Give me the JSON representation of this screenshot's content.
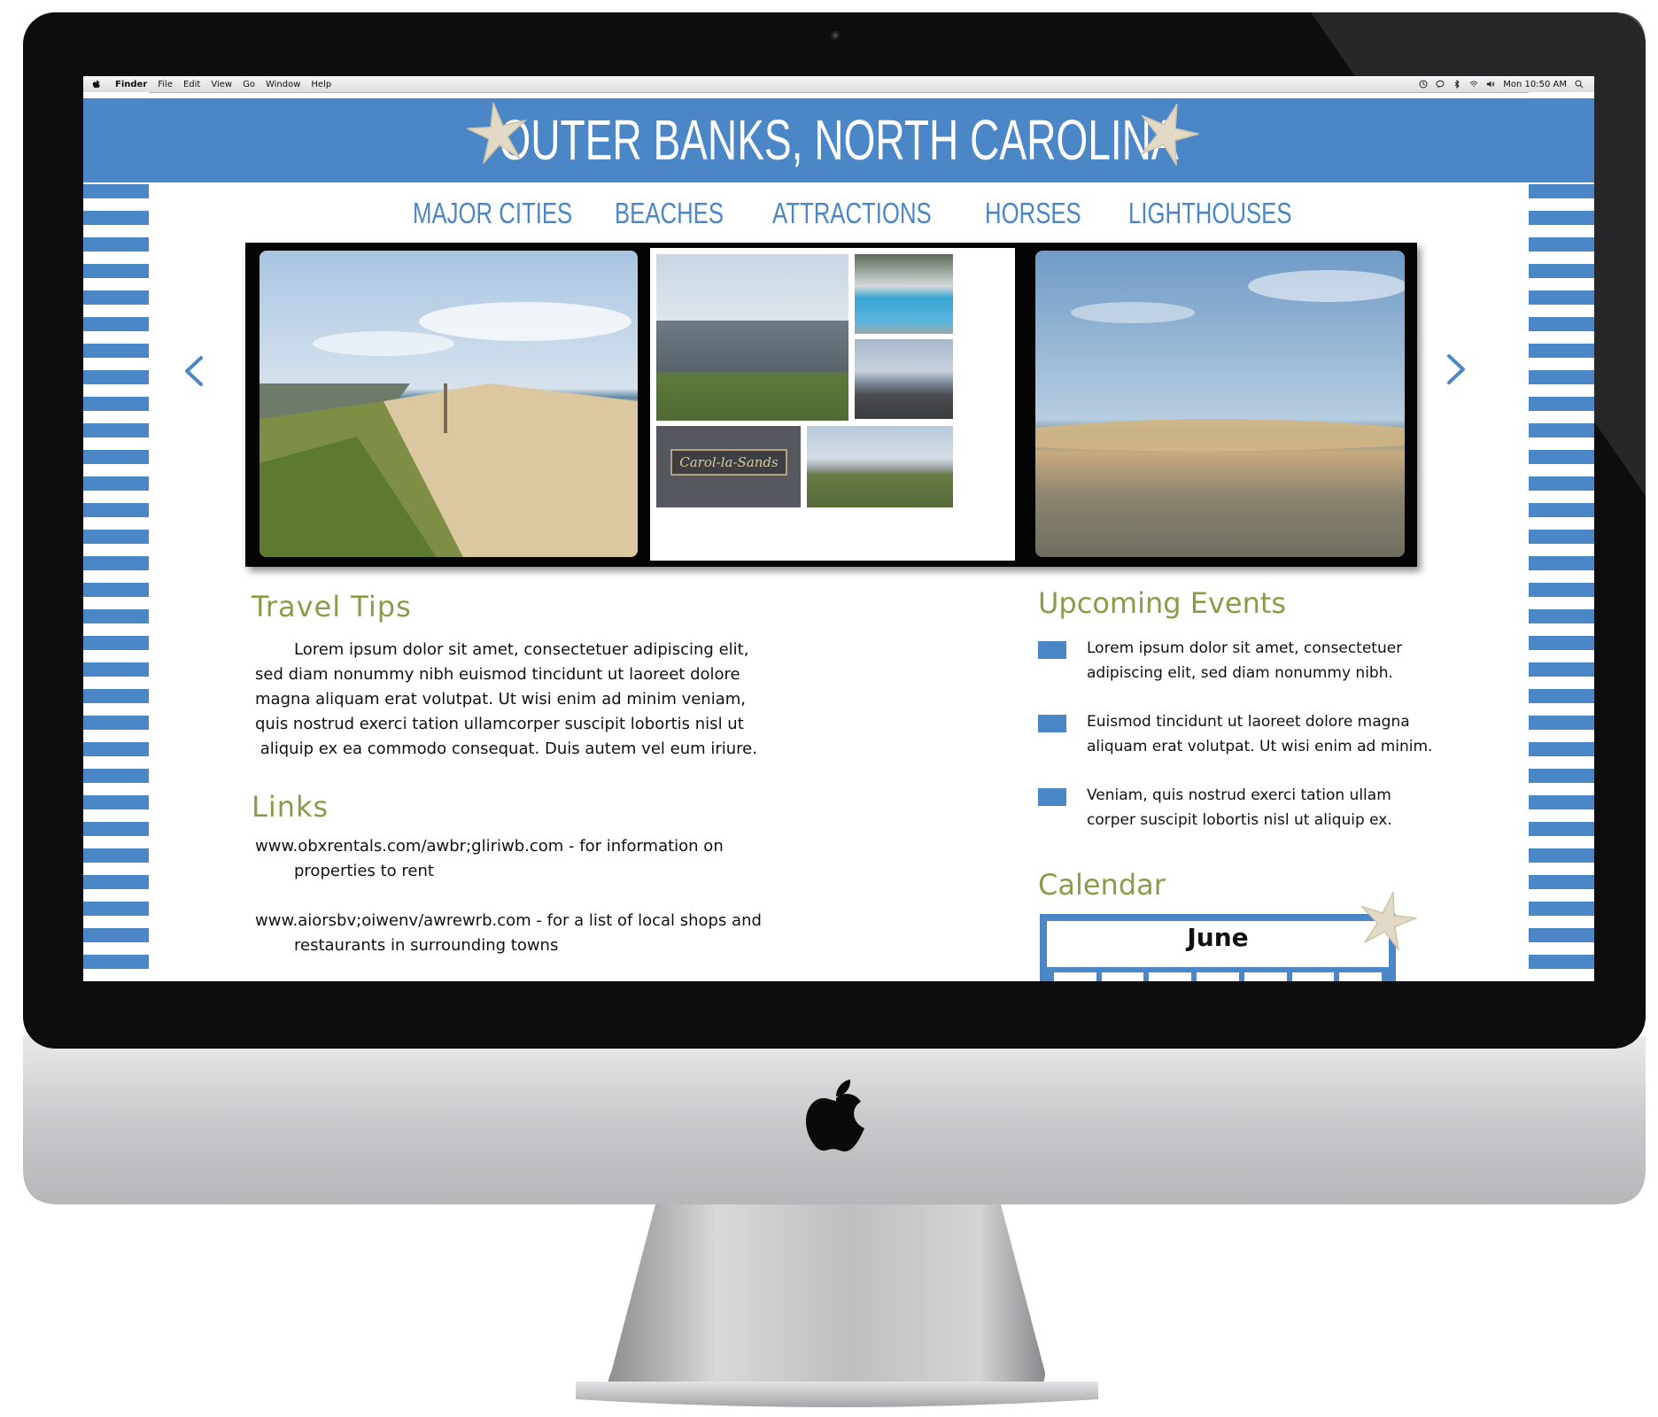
{
  "menubar": {
    "items": [
      "Finder",
      "File",
      "Edit",
      "View",
      "Go",
      "Window",
      "Help"
    ],
    "clock": "Mon 10:50 AM"
  },
  "site": {
    "title": "OUTER BANKS, NORTH CAROLINA",
    "nav": [
      "MAJOR CITIES",
      "BEACHES",
      "ATTRACTIONS",
      "HORSES",
      "LIGHTHOUSES"
    ],
    "carousel": {
      "prev_icon": "chevron-left-icon",
      "next_icon": "chevron-right-icon",
      "sign_text": "Carol-la-Sands"
    },
    "travel_tips": {
      "title": "Travel Tips",
      "lines": [
        "Lorem ipsum dolor sit amet, consectetuer adipiscing elit,",
        "sed diam nonummy nibh euismod tincidunt ut laoreet dolore",
        "magna aliquam erat volutpat. Ut wisi enim ad minim veniam,",
        "quis nostrud exerci tation ullamcorper suscipit lobortis nisl ut",
        " aliquip ex ea commodo consequat. Duis autem vel eum iriure."
      ]
    },
    "links": {
      "title": "Links",
      "items": [
        {
          "line1": "www.obxrentals.com/awbr;gliriwb.com - for information on",
          "line2": "properties to rent"
        },
        {
          "line1": "www.aiorsbv;oiwenv/awrewrb.com - for a list of local shops and",
          "line2": "restaurants in surrounding towns"
        }
      ]
    },
    "events": {
      "title": "Upcoming Events",
      "items": [
        {
          "line1": "Lorem ipsum dolor sit amet, consectetuer",
          "line2": "adipiscing elit, sed diam nonummy nibh."
        },
        {
          "line1": "Euismod tincidunt ut laoreet dolore magna",
          "line2": "aliquam erat volutpat. Ut wisi enim ad minim."
        },
        {
          "line1": "Veniam, quis nostrud exerci tation ullam",
          "line2": "corper suscipit lobortis nisl ut aliquip ex."
        }
      ]
    },
    "calendar": {
      "title": "Calendar",
      "month": "June"
    }
  },
  "colors": {
    "accent_blue": "#4b86c6",
    "heading_olive": "#8c9b4a",
    "starfish": "#e2d9c6"
  }
}
